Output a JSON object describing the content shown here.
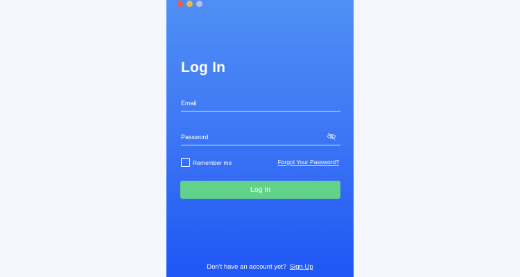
{
  "window": {
    "controls": [
      "close",
      "minimize",
      "zoom"
    ]
  },
  "login": {
    "title": "Log In",
    "email_placeholder": "Email",
    "password_placeholder": "Password",
    "remember_label": "Remember me",
    "remember_checked": false,
    "forgot_link": "Forgot Your Password?",
    "submit_label": "Log In",
    "signup_prompt": "Don't have an account yet?",
    "signup_link": "Sign Up"
  },
  "icons": {
    "password_toggle": "eye-slash-icon"
  },
  "colors": {
    "background": "#f4f7fd",
    "gradient_top": "#4f8ff5",
    "gradient_bottom": "#1f56f5",
    "button": "#62d28a",
    "text": "#ffffff"
  }
}
